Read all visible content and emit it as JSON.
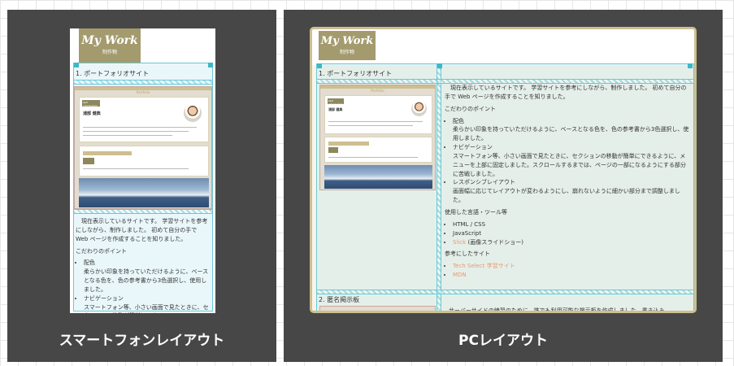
{
  "smartphone": {
    "caption": "スマートフォンレイアウト"
  },
  "pc": {
    "caption": "PCレイアウト"
  },
  "logo": {
    "title": "My Work",
    "subtitle": "制作物"
  },
  "thumb": {
    "title": "Portfolio",
    "logo": "Self introduction",
    "name": "浦部 健典"
  },
  "section1": {
    "title": "1. ポートフォリオサイト"
  },
  "section2": {
    "title": "2. 匿名掲示板",
    "intro": "サーバーサイドの練習のために、誰でも利用可能な掲示板を作成しました。書き込み"
  },
  "content": {
    "intro": "現在表示しているサイトです。 学習サイトを参考にしながら、制作しました。 初めて自分の手で Web ページを作成することを知りました。",
    "points_heading": "こだわりのポイント",
    "points": [
      {
        "title": "配色",
        "desc": "柔らかい印象を持っていただけるように、ベースとなる色を、色の参考書から3色選択し、使用しました。"
      },
      {
        "title": "ナビゲーション",
        "desc": "スマートフォン等、小さい画面で見たときに、セクションの移動が簡単にできるように、メニューを上部に固定しました。スクロールするまでは、ページの一部になるようにする部分に苦戦しました。"
      },
      {
        "title": "レスポンシブレイアウト",
        "desc": "画面幅に応じてレイアウトが変わるようにし、崩れないように細かい部分まで調整しました。"
      }
    ],
    "tools_heading": "使用した言語・ツール等",
    "tools": [
      "HTML / CSS",
      "JavaScript"
    ],
    "tool_slick": "Slick",
    "tool_slick_note": "(画像スライドショー)",
    "refs_heading": "参考にしたサイト",
    "refs": [
      "Tech Select 学習サイト",
      "MDN"
    ]
  },
  "phone_points": [
    {
      "title": "配色",
      "desc": "柔らかい印象を持っていただけるように、ベースとなる色を、色の参考書から3色選択し、使用しました。"
    },
    {
      "title": "ナビゲーション",
      "desc": "スマートフォン等、小さい画面で見たときに、セクションの移動が簡単にできる"
    }
  ],
  "markers": {
    "m1": "1",
    "m2": "2",
    "m3": "3",
    "m4": "4",
    "m11": "11",
    "m12": "12",
    "m13": "13"
  },
  "colors": {
    "panel": "#474747",
    "accent": "#a39b6e",
    "overlay": "#67c9d6",
    "link": "#e69a6d"
  }
}
